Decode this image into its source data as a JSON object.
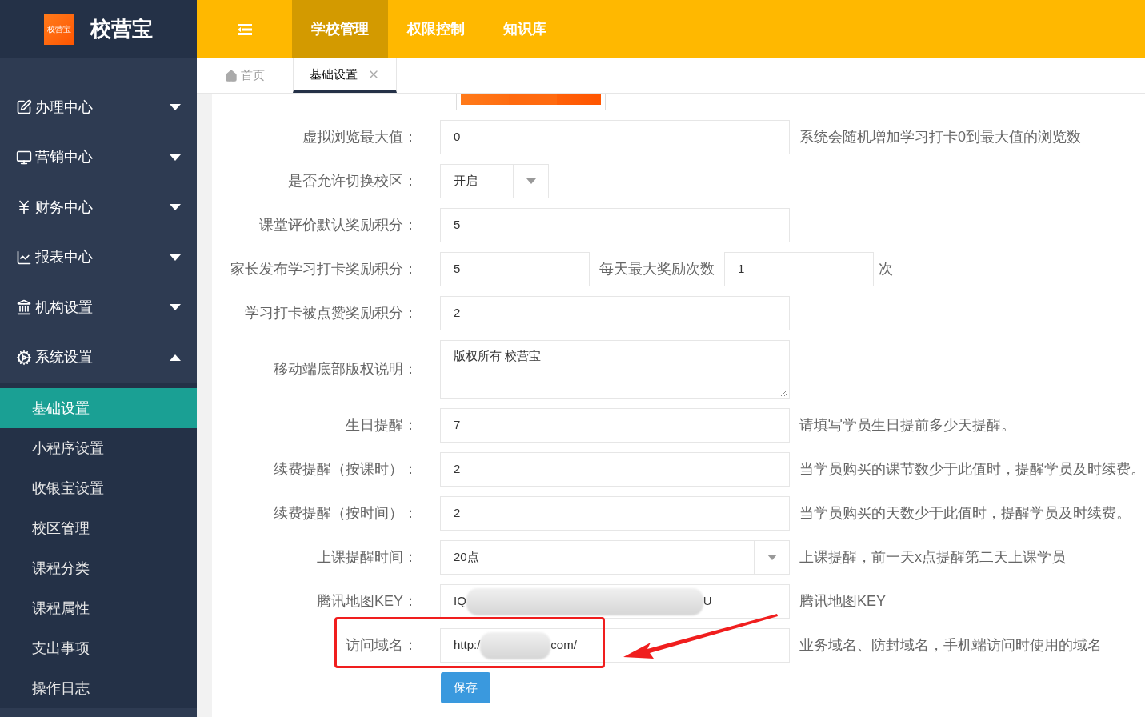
{
  "logo": {
    "badge": "校营宝",
    "title": "校营宝"
  },
  "top_nav": [
    {
      "label": "学校管理",
      "selected": true
    },
    {
      "label": "权限控制",
      "selected": false
    },
    {
      "label": "知识库",
      "selected": false
    }
  ],
  "page_tabs": [
    {
      "label": "首页",
      "kind": "home",
      "selected": false
    },
    {
      "label": "基础设置",
      "kind": "closable",
      "selected": true
    }
  ],
  "sidebar": {
    "items": [
      {
        "label": "办理中心",
        "expanded": false
      },
      {
        "label": "营销中心",
        "expanded": false
      },
      {
        "label": "财务中心",
        "expanded": false
      },
      {
        "label": "报表中心",
        "expanded": false
      },
      {
        "label": "机构设置",
        "expanded": false
      },
      {
        "label": "系统设置",
        "expanded": true,
        "children": [
          {
            "label": "基础设置",
            "selected": true
          },
          {
            "label": "小程序设置",
            "selected": false
          },
          {
            "label": "收银宝设置",
            "selected": false
          },
          {
            "label": "校区管理",
            "selected": false
          },
          {
            "label": "课程分类",
            "selected": false
          },
          {
            "label": "课程属性",
            "selected": false
          },
          {
            "label": "支出事项",
            "selected": false
          },
          {
            "label": "操作日志",
            "selected": false
          }
        ]
      }
    ]
  },
  "form": {
    "rows": [
      {
        "kind": "text",
        "label": "虚拟浏览最大值：",
        "value": "0",
        "hint": "系统会随机增加学习打卡0到最大值的浏览数"
      },
      {
        "kind": "select",
        "label": "是否允许切换校区：",
        "value": "开启",
        "short": true
      },
      {
        "kind": "text",
        "label": "课堂评价默认奖励积分：",
        "value": "5"
      },
      {
        "kind": "double",
        "label": "家长发布学习打卡奖励积分：",
        "value": "5",
        "second_label": "每天最大奖励次数",
        "second_value": "1",
        "unit": "次"
      },
      {
        "kind": "text",
        "label": "学习打卡被点赞奖励积分：",
        "value": "2"
      },
      {
        "kind": "textarea",
        "label": "移动端底部版权说明：",
        "value": "版权所有 校营宝"
      },
      {
        "kind": "text",
        "label": "生日提醒：",
        "value": "7",
        "hint": "请填写学员生日提前多少天提醒。"
      },
      {
        "kind": "text",
        "label": "续费提醒（按课时）：",
        "value": "2",
        "hint": "当学员购买的课节数少于此值时，提醒学员及时续费。"
      },
      {
        "kind": "text",
        "label": "续费提醒（按时间）：",
        "value": "2",
        "hint": "当学员购买的天数少于此值时，提醒学员及时续费。"
      },
      {
        "kind": "select",
        "label": "上课提醒时间：",
        "value": "20点",
        "short": false,
        "hint": "上课提醒，前一天x点提醒第二天上课学员"
      },
      {
        "kind": "secret",
        "label": "腾讯地图KEY：",
        "prefix": "IQ",
        "suffix": "U",
        "hint": "腾讯地图KEY",
        "annotated": false
      },
      {
        "kind": "secret",
        "label": "访问域名：",
        "prefix": "http:/",
        "suffix": "com/",
        "hint": "业务域名、防封域名，手机端访问时使用的域名",
        "annotated": true
      }
    ],
    "save_button": "保存"
  }
}
